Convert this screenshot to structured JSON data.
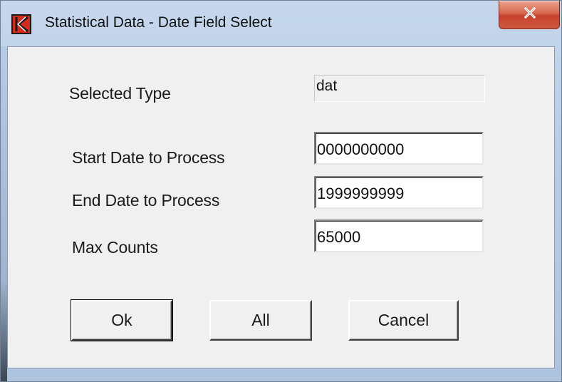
{
  "window": {
    "title": "Statistical Data - Date Field Select",
    "app_icon": "k-logo-icon",
    "close_icon": "close-icon"
  },
  "form": {
    "selected_type_label": "Selected Type",
    "selected_type_value": "dat",
    "start_date_label": "Start Date to Process",
    "start_date_value": "0000000000",
    "end_date_label": "End Date to Process",
    "end_date_value": "1999999999",
    "max_counts_label": "Max Counts",
    "max_counts_value": "65000"
  },
  "buttons": {
    "ok_label": "Ok",
    "all_label": "All",
    "cancel_label": "Cancel"
  },
  "colors": {
    "close_button": "#c7402a",
    "client_background": "#f0f0f0",
    "titlebar": "#b7cbe4"
  }
}
